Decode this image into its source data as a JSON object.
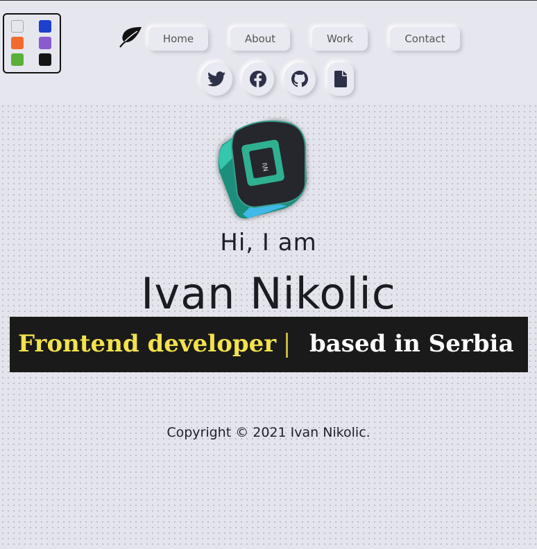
{
  "palette": {
    "swatches": [
      {
        "name": "light",
        "color": "#e6e6ee"
      },
      {
        "name": "blue",
        "color": "#1f3fcf"
      },
      {
        "name": "orange",
        "color": "#f26b2e"
      },
      {
        "name": "purple",
        "color": "#8a5bd0"
      },
      {
        "name": "green",
        "color": "#5bb03a"
      },
      {
        "name": "black",
        "color": "#151515"
      }
    ]
  },
  "nav": {
    "items": [
      {
        "label": "Home"
      },
      {
        "label": "About"
      },
      {
        "label": "Work"
      },
      {
        "label": "Contact"
      }
    ]
  },
  "social": {
    "items": [
      {
        "icon": "twitter-icon"
      },
      {
        "icon": "facebook-icon"
      },
      {
        "icon": "github-icon"
      },
      {
        "icon": "document-icon"
      }
    ]
  },
  "hero": {
    "greeting": "Hi, I am",
    "name": "Ivan Nikolic",
    "role": "Frontend developer",
    "location": "based in Serbia"
  },
  "footer": {
    "copyright": "Copyright © 2021 Ivan Nikolic."
  },
  "colors": {
    "role_text": "#f2e24c",
    "banner_bg": "#1a1a1a",
    "page_bg": "#e4e4ec",
    "logo_teal": "#1f9c84"
  }
}
